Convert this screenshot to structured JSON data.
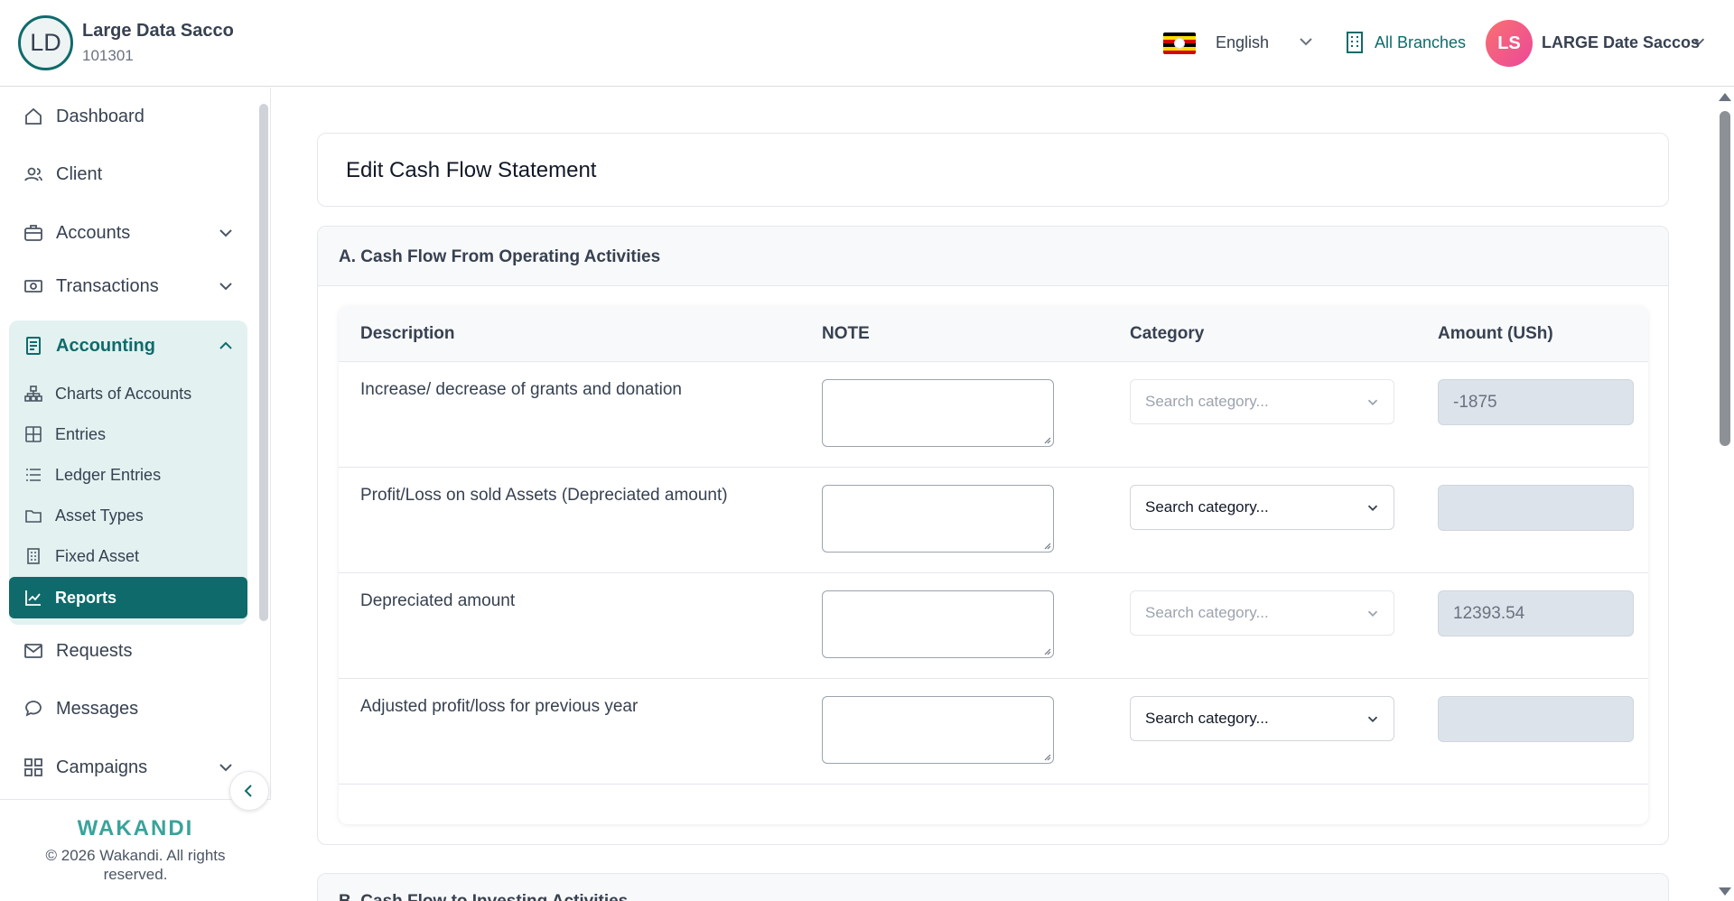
{
  "header": {
    "org_initials": "LD",
    "org_name": "Large Data Sacco",
    "org_code": "101301",
    "language": "English",
    "branches": "All Branches",
    "user_initials": "LS",
    "user_name": "LARGE Date Saccos"
  },
  "sidebar": {
    "items": [
      {
        "label": "Dashboard",
        "icon": "home-icon"
      },
      {
        "label": "Client",
        "icon": "users-icon"
      },
      {
        "label": "Accounts",
        "icon": "briefcase-icon"
      },
      {
        "label": "Transactions",
        "icon": "cash-icon"
      },
      {
        "label": "Accounting",
        "icon": "document-icon"
      },
      {
        "label": "Requests",
        "icon": "mail-icon"
      },
      {
        "label": "Messages",
        "icon": "chat-icon"
      },
      {
        "label": "Campaigns",
        "icon": "grid-icon"
      }
    ],
    "accounting_sub": [
      {
        "label": "Charts of Accounts",
        "icon": "hierarchy-icon"
      },
      {
        "label": "Entries",
        "icon": "table-icon"
      },
      {
        "label": "Ledger Entries",
        "icon": "list-icon"
      },
      {
        "label": "Asset Types",
        "icon": "folder-icon"
      },
      {
        "label": "Fixed Asset",
        "icon": "building-icon"
      },
      {
        "label": "Reports",
        "icon": "chart-icon"
      }
    ],
    "brand": "WAKANDI",
    "copyright": "© 2026 Wakandi. All rights reserved."
  },
  "main": {
    "title": "Edit Cash Flow Statement",
    "section_a": "A. Cash Flow From Operating Activities",
    "section_b": "B. Cash Flow to Investing Activities",
    "columns": [
      "Description",
      "NOTE",
      "Category",
      "Amount (USh)"
    ],
    "rows": [
      {
        "description": "Increase/ decrease of grants and donation",
        "category": "Search category...",
        "amount": "-1875"
      },
      {
        "description": "Profit/Loss on sold Assets (Depreciated amount)",
        "category": "Search category...",
        "amount": ""
      },
      {
        "description": "Depreciated amount",
        "category": "Search category...",
        "amount": "12393.54"
      },
      {
        "description": "Adjusted profit/loss for previous year",
        "category": "Search category...",
        "amount": ""
      }
    ]
  },
  "colors": {
    "accent": "#0f6b6b",
    "accounting_bg": "#e3f1f1"
  }
}
